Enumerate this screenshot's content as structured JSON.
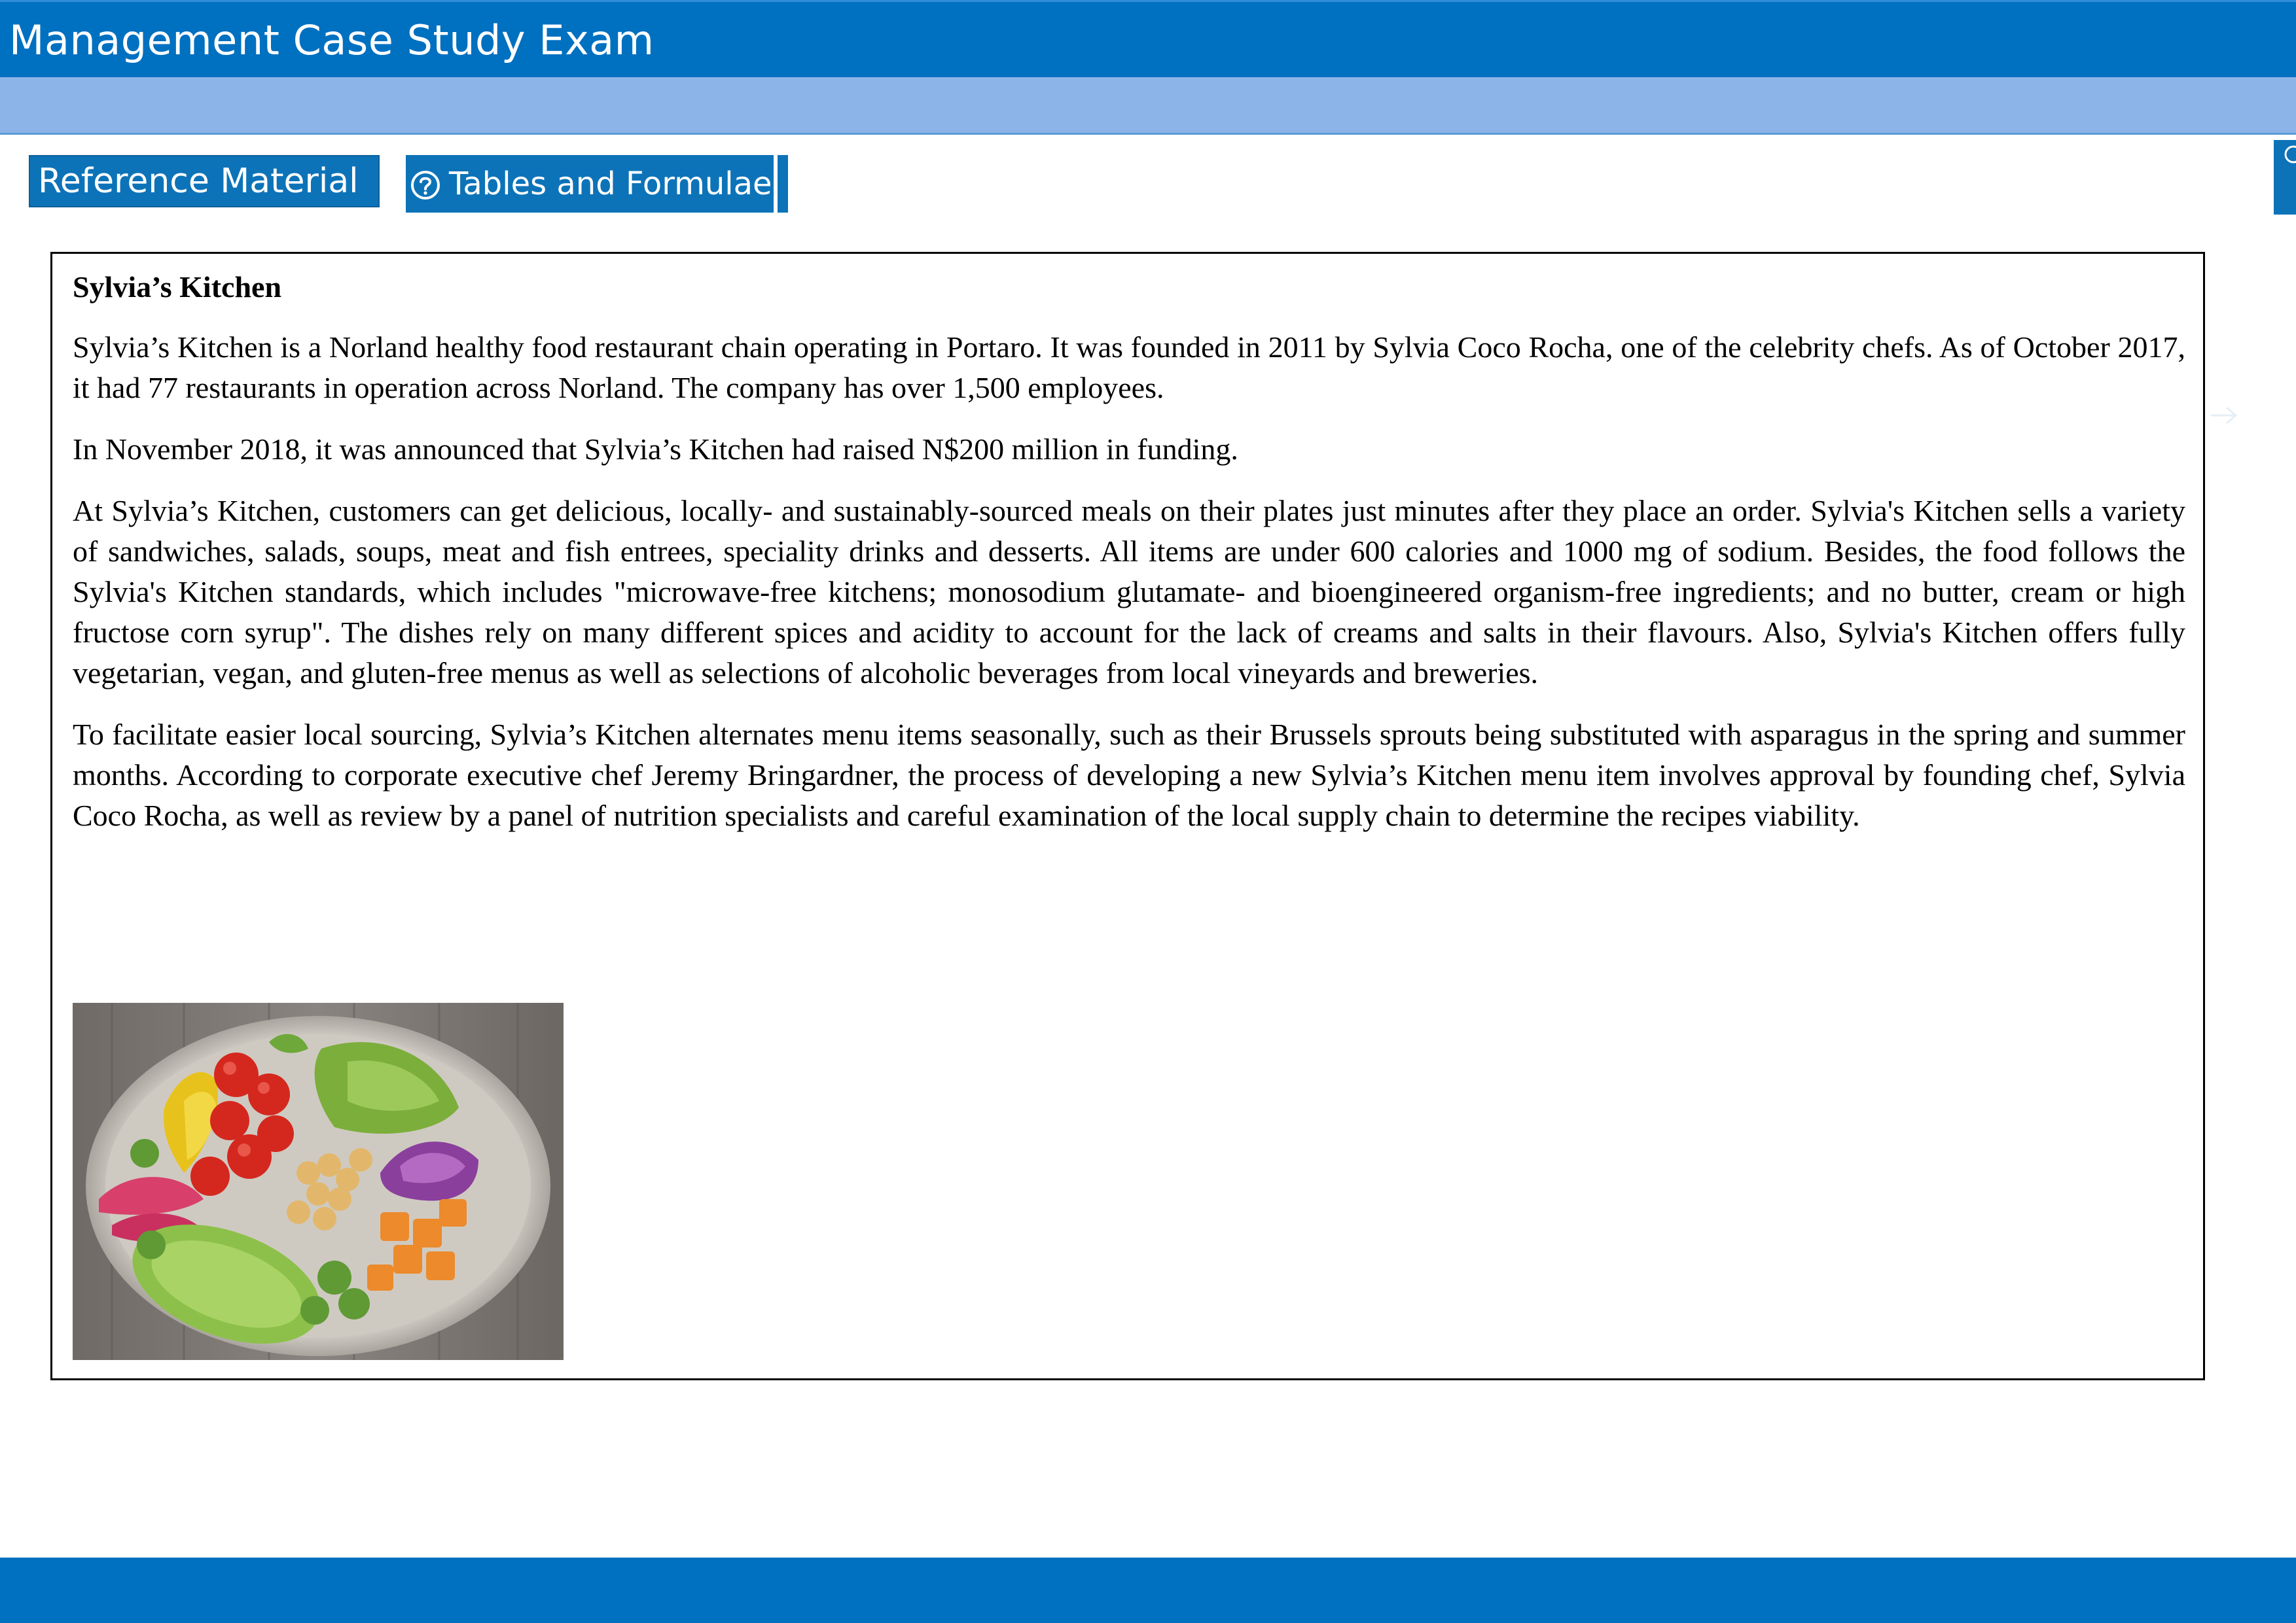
{
  "header": {
    "title": "Management Case Study Exam"
  },
  "toolbar": {
    "reference_material_label": "Reference Material",
    "tables_formulae_label": "Tables and Formulae",
    "tables_formulae_icon": "help-circle-icon"
  },
  "colors": {
    "header_blue": "#0070c0",
    "subbar_blue": "#8db4e8",
    "button_blue": "#0d73b8"
  },
  "case": {
    "title": "Sylvia’s Kitchen",
    "paragraphs": [
      "Sylvia’s Kitchen is a Norland healthy food restaurant chain operating in Portaro. It was founded in 2011 by Sylvia Coco Rocha, one of the celebrity chefs. As of October 2017, it had 77 restaurants in operation across Norland. The company has over 1,500 employees.",
      "In November 2018, it was announced that Sylvia’s Kitchen had raised N$200 million in funding.",
      "At Sylvia’s Kitchen, customers can get delicious, locally- and sustainably-sourced meals on their plates just minutes after they place an order. Sylvia's Kitchen sells a variety of sandwiches, salads, soups, meat and fish entrees, speciality drinks and desserts. All items are under 600 calories and 1000 mg of sodium. Besides, the food follows the Sylvia's Kitchen standards, which includes \"microwave-free kitchens; monosodium glutamate- and bioengineered organism-free ingredients; and no butter, cream or high fructose corn syrup\". The dishes rely on many different spices and acidity to account for the lack of creams and salts in their flavours. Also, Sylvia's Kitchen offers fully vegetarian, vegan, and gluten-free menus as well as selections of alcoholic beverages from local vineyards and breweries.",
      "To facilitate easier local sourcing, Sylvia’s Kitchen alternates menu items seasonally, such as their Brussels sprouts being substituted with asparagus in the spring and summer months. According to corporate executive chef Jeremy Bringardner, the process of developing a new Sylvia’s Kitchen menu item involves approval by founding chef, Sylvia Coco Rocha, as well as review by a panel of nutrition specialists and careful examination of the local supply chain to determine the recipes viability."
    ]
  }
}
